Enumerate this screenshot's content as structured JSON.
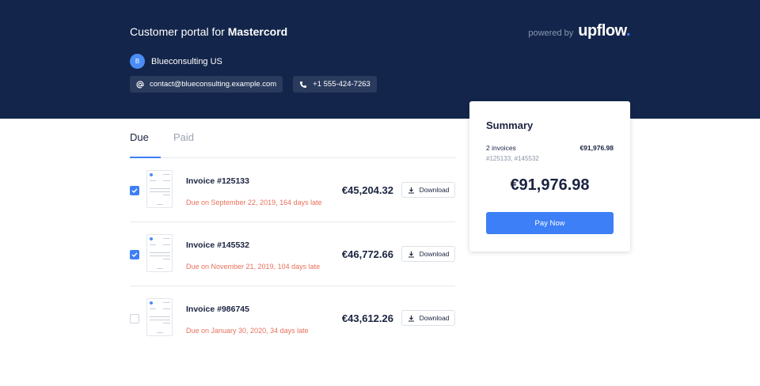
{
  "header": {
    "title_prefix": "Customer portal for",
    "title_company": "Mastercord",
    "powered_label": "powered by",
    "brand_name": "upflow",
    "brand_dot": ".",
    "colors": {
      "background": "#13254a",
      "accent": "#3d7ff6"
    }
  },
  "account": {
    "avatar_letter": "B",
    "name": "Blueconsulting US",
    "email_icon": "at-sign-icon",
    "email": "contact@blueconsulting.example.com",
    "phone_icon": "phone-icon",
    "phone": "+1 555-424-7263"
  },
  "tabs": [
    {
      "label": "Due",
      "active": true
    },
    {
      "label": "Paid",
      "active": false
    }
  ],
  "invoices": [
    {
      "title": "Invoice #125133",
      "due_text": "Due on September 22, 2019, 164 days late",
      "amount": "€45,204.32",
      "selected": true
    },
    {
      "title": "Invoice #145532",
      "due_text": "Due on November 21, 2019, 104 days late",
      "amount": "€46,772.66",
      "selected": true
    },
    {
      "title": "Invoice #986745",
      "due_text": "Due on January 30, 2020, 34 days late",
      "amount": "€43,612.26",
      "selected": false
    }
  ],
  "download_label": "Download",
  "download_icon": "download-icon",
  "summary": {
    "title": "Summary",
    "count_label": "2 invoices",
    "count_amount": "€91,976.98",
    "refs": "#125133, #145532",
    "total": "€91,976.98",
    "pay_label": "Pay Now"
  }
}
